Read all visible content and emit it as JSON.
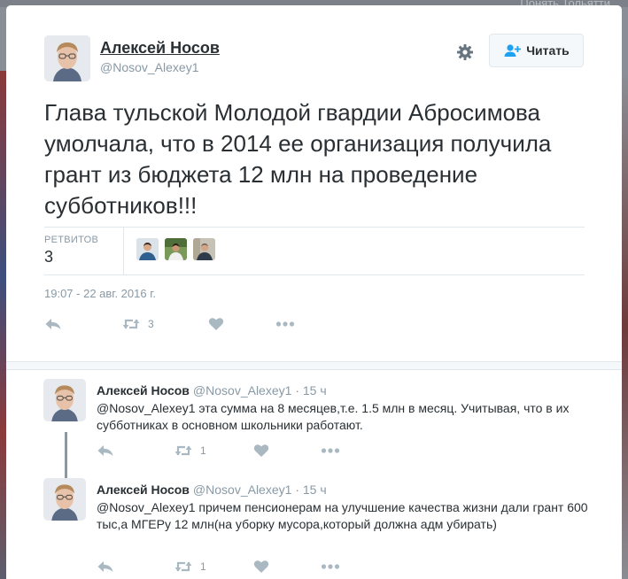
{
  "backdrop": {
    "top_right_text": "Понять Тольятти"
  },
  "main_tweet": {
    "author_name": "Алексей Носов",
    "author_handle": "@Nosov_Alexey1",
    "follow_label": "Читать",
    "text": "Глава тульской Молодой гвардии Абросимова умолчала, что в 2014 ее организация получила грант из бюджета 12 млн на проведение субботников!!!",
    "retweets_label": "РЕТВИТОВ",
    "retweets_count": "3",
    "timestamp": "19:07 - 22 авг. 2016 г.",
    "actions": {
      "retweet_count": "3"
    }
  },
  "replies": [
    {
      "author_name": "Алексей Носов",
      "author_handle": "@Nosov_Alexey1",
      "time": "· 15 ч",
      "text": "@Nosov_Alexey1 эта сумма на 8 месяцев,т.е. 1.5 млн в месяц. Учитывая, что в их субботниках в основном школьники работают.",
      "retweet_count": "1"
    },
    {
      "author_name": "Алексей Носов",
      "author_handle": "@Nosov_Alexey1",
      "time": "· 15 ч",
      "text": "@Nosov_Alexey1 причем пенсионерам на улучшение качества жизни дали грант 600 тыс,а МГЕРу 12 млн(на уборку мусора,который должна адм убирать)",
      "retweet_count": "1"
    }
  ],
  "icons": [
    "reply-icon",
    "retweet-icon",
    "like-icon",
    "more-icon",
    "gear-icon",
    "follow-user-icon"
  ],
  "colors": {
    "text": "#292f33",
    "secondary": "#8899a6",
    "border": "#e1e8ed",
    "icon": "#aab8c2"
  }
}
